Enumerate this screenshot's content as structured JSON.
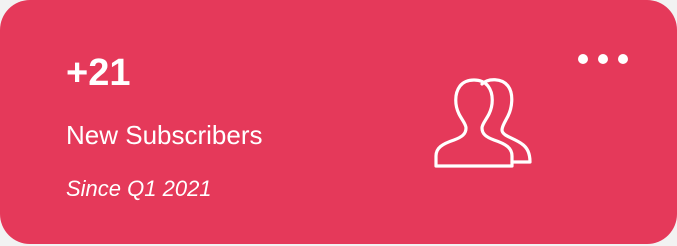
{
  "card": {
    "count": "+21",
    "label": "New Subscribers",
    "since": "Since Q1 2021",
    "icon": "users-icon",
    "menu_icon": "more-horizontal-icon",
    "background_color": "#e5395a",
    "text_color": "#ffffff"
  }
}
